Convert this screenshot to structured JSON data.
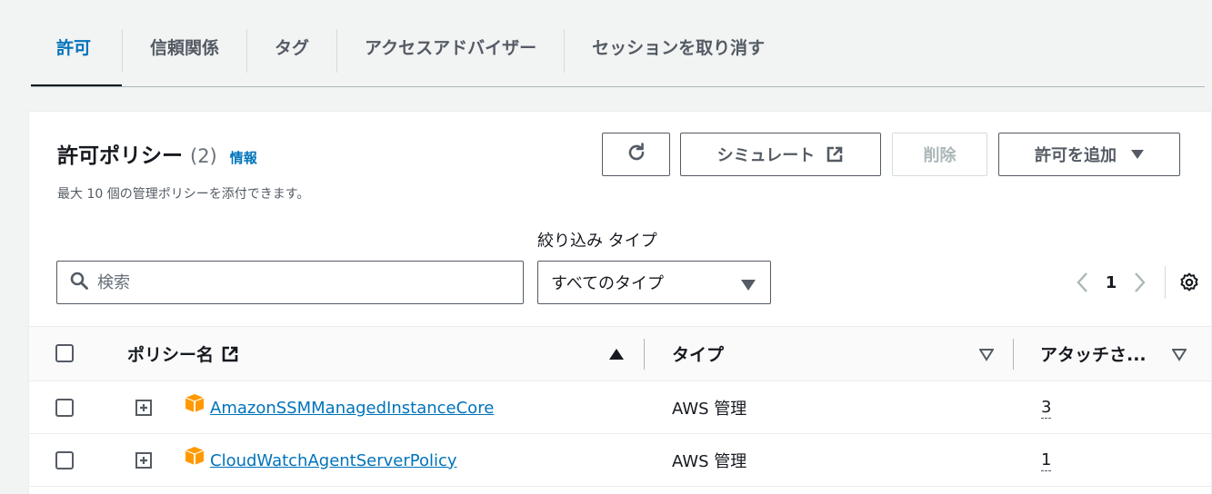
{
  "tabs": [
    {
      "label": "許可",
      "active": true
    },
    {
      "label": "信頼関係",
      "active": false
    },
    {
      "label": "タグ",
      "active": false
    },
    {
      "label": "アクセスアドバイザー",
      "active": false
    },
    {
      "label": "セッションを取り消す",
      "active": false
    }
  ],
  "panel": {
    "title": "許可ポリシー",
    "count": "(2)",
    "info_link": "情報",
    "description": "最大 10 個の管理ポリシーを添付できます。",
    "buttons": {
      "simulate": "シミュレート",
      "delete": "削除",
      "add_permissions": "許可を追加"
    },
    "filter_label": "絞り込み タイプ",
    "search_placeholder": "検索",
    "type_select_value": "すべてのタイプ",
    "pager_page": "1"
  },
  "table": {
    "columns": {
      "policy_name": "ポリシー名",
      "type": "タイプ",
      "attached": "アタッチさ..."
    },
    "rows": [
      {
        "name": "AmazonSSMManagedInstanceCore",
        "type": "AWS 管理",
        "attached": "3"
      },
      {
        "name": "CloudWatchAgentServerPolicy",
        "type": "AWS 管理",
        "attached": "1"
      }
    ]
  },
  "colors": {
    "accent": "#0073bb",
    "aws_icon": "#ff9900",
    "text": "#16191f",
    "muted": "#545b64"
  },
  "icons": [
    "refresh-icon",
    "external-link-icon",
    "caret-down-icon",
    "search-icon",
    "chevron-left-icon",
    "chevron-right-icon",
    "settings-icon",
    "sort-asc-icon",
    "sort-desc-icon",
    "expand-icon",
    "aws-managed-policy-icon"
  ]
}
